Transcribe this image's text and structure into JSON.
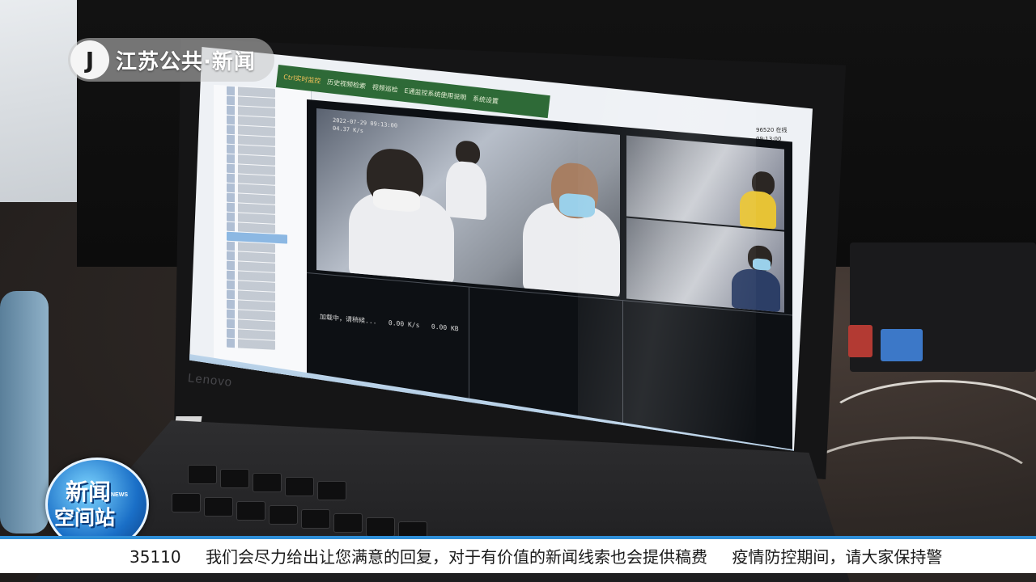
{
  "broadcast": {
    "channel_logo_mark": "J",
    "channel_logo_text": "江苏公共·新闻",
    "program_badge_line1": "新闻",
    "program_badge_line2": "空间站",
    "program_badge_small": "NEWS",
    "ticker": [
      "35110",
      "我们会尽力给出让您满意的回复，对于有价值的新闻线索也会提供稿费",
      "疫情防控期间，请大家保持警"
    ]
  },
  "laptop": {
    "brand": "Lenovo",
    "menu": [
      "Ctrl实时监控",
      "历史视频检索",
      "视频巡检",
      "E通监控系统使用说明",
      "系统设置"
    ],
    "status": {
      "line1": "96520 在线",
      "line2": "09:13:00"
    },
    "camera_overlay": {
      "date": "2022-07-29 09:13:00",
      "speed": "04.37 K/s"
    },
    "loading_text": "加载中，请稍候...   0.00 K/s   0.00 KB"
  }
}
